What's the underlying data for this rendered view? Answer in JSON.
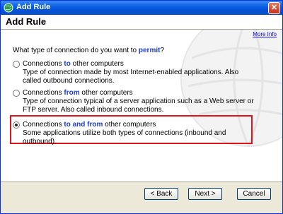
{
  "window": {
    "title": "Add Rule",
    "close_glyph": "✕"
  },
  "header": {
    "title": "Add Rule"
  },
  "links": {
    "more_info": "More Info"
  },
  "question": {
    "prefix": "What type of connection do you want to ",
    "keyword": "permit",
    "suffix": "?"
  },
  "options": [
    {
      "pre": "Connections ",
      "keyword": "to",
      "post": " other computers",
      "desc": "Type of connection made by most Internet-enabled applications. Also called outbound connections.",
      "checked": false
    },
    {
      "pre": "Connections ",
      "keyword": "from",
      "post": " other computers",
      "desc": "Type of connection typical of a server application such as a Web server or FTP server. Also called inbound connections.",
      "checked": false
    },
    {
      "pre": "Connections ",
      "keyword": "to and from",
      "post": " other computers",
      "desc": "Some applications utilize both types of connections (inbound and outbound).",
      "checked": true
    }
  ],
  "buttons": {
    "back": "< Back",
    "next": "Next >",
    "cancel": "Cancel"
  },
  "colors": {
    "highlight_border": "#e0131d",
    "keyword": "#1c3ec4"
  },
  "icons": {
    "app": "globe-icon"
  }
}
